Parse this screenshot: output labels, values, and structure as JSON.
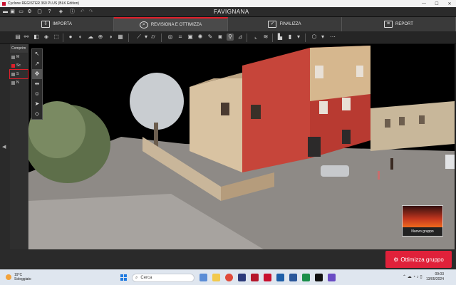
{
  "window": {
    "title": "Cyclone REGISTER 360 PLUS (BLK Edition)",
    "controls": [
      "minimize-icon",
      "maximize-icon",
      "close-icon"
    ]
  },
  "project": {
    "name": "FAVIGNANA"
  },
  "workflow": {
    "tabs": [
      {
        "label": "IMPORTA",
        "icon": "import-icon"
      },
      {
        "label": "REVISIONA E OTTIMIZZA",
        "icon": "review-icon",
        "active": true
      },
      {
        "label": "FINALIZZA",
        "icon": "finalize-icon"
      },
      {
        "label": "REPORT",
        "icon": "report-icon"
      }
    ]
  },
  "tree": {
    "header": "Comprim",
    "rows": [
      "M",
      "Sc",
      "S",
      "N"
    ]
  },
  "viewport": {
    "thumbnail_label": "Nuovo gruppo"
  },
  "actions": {
    "optimize_label": "Ottimizza gruppo"
  },
  "taskbar": {
    "weather_temp": "19°C",
    "weather_desc": "Soleggiato",
    "search_placeholder": "Cerca",
    "time": "09:03",
    "date": "13/05/2024"
  },
  "colors": {
    "accent": "#e0213a",
    "tab_active_border": "#e0202b"
  }
}
